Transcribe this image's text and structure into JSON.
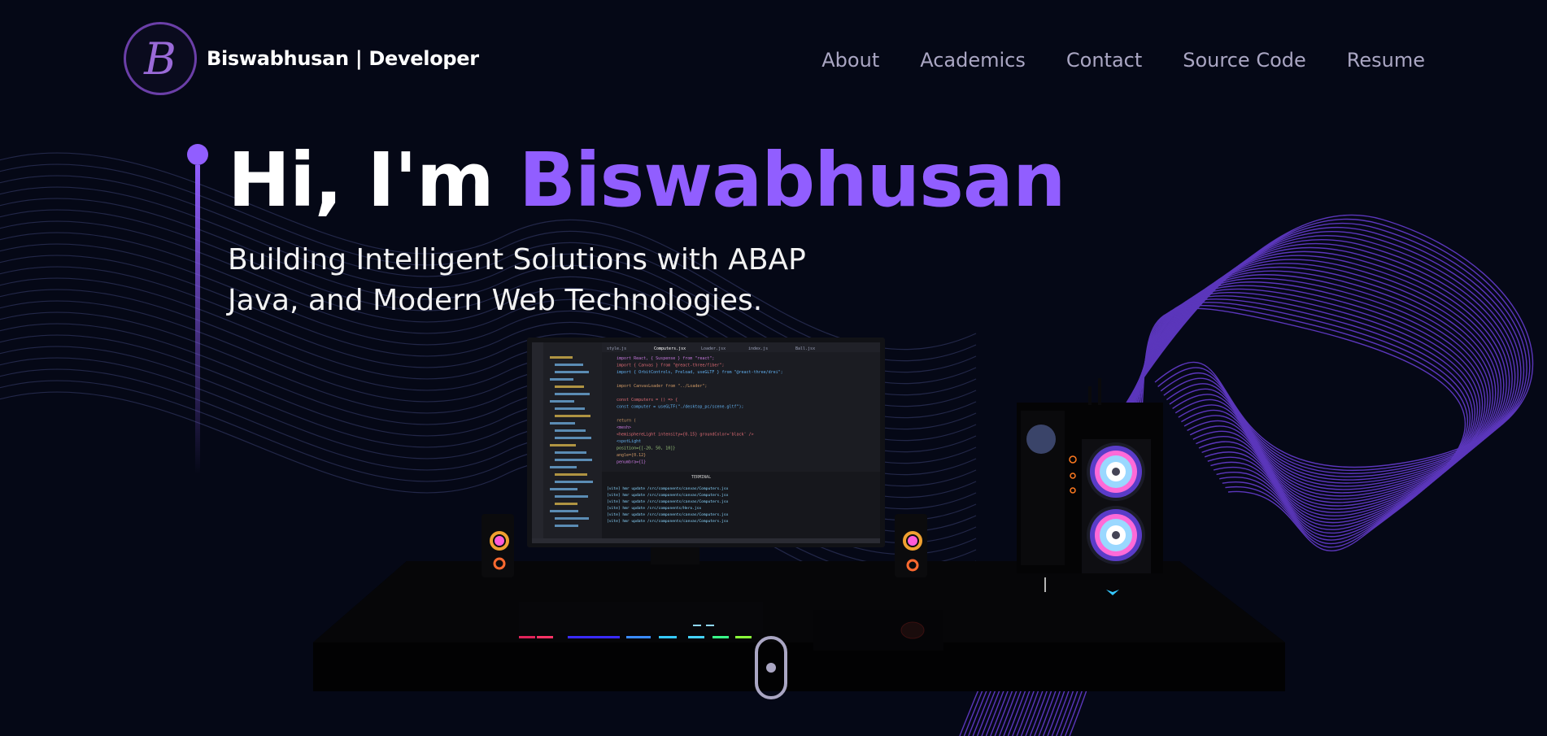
{
  "nav": {
    "logo_letter": "B",
    "brand": "Biswabhusan | Developer",
    "links": [
      {
        "label": "About"
      },
      {
        "label": "Academics"
      },
      {
        "label": "Contact"
      },
      {
        "label": "Source Code"
      },
      {
        "label": "Resume"
      }
    ]
  },
  "hero": {
    "greeting": "Hi, I'm ",
    "name": "Biswabhusan",
    "subtitle_line1": "Building Intelligent Solutions with ABAP",
    "subtitle_line2": "Java, and Modern Web Technologies."
  },
  "scene": {
    "editor": {
      "tabs": [
        "style.js",
        "Computers.jsx",
        "Loader.jsx",
        "index.js",
        "Ball.jsx"
      ],
      "code_lines": [
        "import React, { Suspense } from \"react\";",
        "import { Canvas } from \"@react-three/fiber\";",
        "import { OrbitControls, Preload, useGLTF } from \"@react-three/drei\";",
        "",
        "import CanvasLoader from \"../Loader\";",
        "",
        "const Computers = () => {",
        "  const computer = useGLTF(\"./desktop_pc/scene.gltf\");",
        "",
        "  return (",
        "    <mesh>",
        "      <hemisphereLight intensity={0.15} groundColor='black' />",
        "      <spotLight",
        "        position={[-20, 50, 10]}",
        "        angle={0.12}",
        "        penumbra={1}"
      ],
      "terminal_title": "TERMINAL",
      "terminal_lines": [
        "[vite] hmr update /src/components/canvas/Computers.jsx",
        "[vite] hmr update /src/components/canvas/Computers.jsx",
        "[vite] hmr update /src/components/canvas/Computers.jsx",
        "[vite] hmr update /src/components/Hero.jsx",
        "[vite] hmr update /src/components/canvas/Computers.jsx",
        "[vite] hmr update /src/components/canvas/Computers.jsx"
      ]
    }
  },
  "colors": {
    "background": "#050816",
    "accent": "#915eff",
    "nav_text": "#aaa6c3",
    "white": "#ffffff"
  }
}
